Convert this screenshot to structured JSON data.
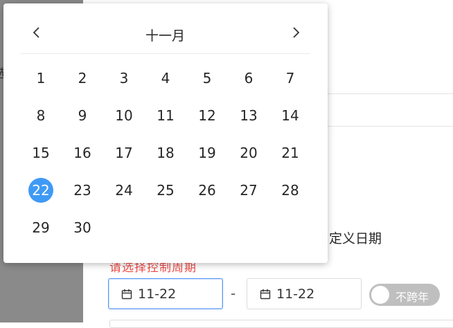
{
  "background": {
    "partial_left_text": "选",
    "custom_date_option": "自定义日期",
    "warning_text": "请选择控制周期",
    "start_date": "11-22",
    "range_separator": "-",
    "end_date": "11-22",
    "cross_year_toggle": {
      "label": "不跨年",
      "on": false
    }
  },
  "calendar": {
    "month_title": "十一月",
    "prev_icon": "chevron-left-icon",
    "next_icon": "chevron-right-icon",
    "selected_day": "22",
    "weeks": [
      [
        "1",
        "2",
        "3",
        "4",
        "5",
        "6",
        "7"
      ],
      [
        "8",
        "9",
        "10",
        "11",
        "12",
        "13",
        "14"
      ],
      [
        "15",
        "16",
        "17",
        "18",
        "19",
        "20",
        "21"
      ],
      [
        "22",
        "23",
        "24",
        "25",
        "26",
        "27",
        "28"
      ],
      [
        "29",
        "30"
      ]
    ]
  },
  "colors": {
    "selected": "#3f9af6",
    "warning": "#ee4a45",
    "active_border": "#5a9af4",
    "toggle_off": "#bfbfbf"
  }
}
